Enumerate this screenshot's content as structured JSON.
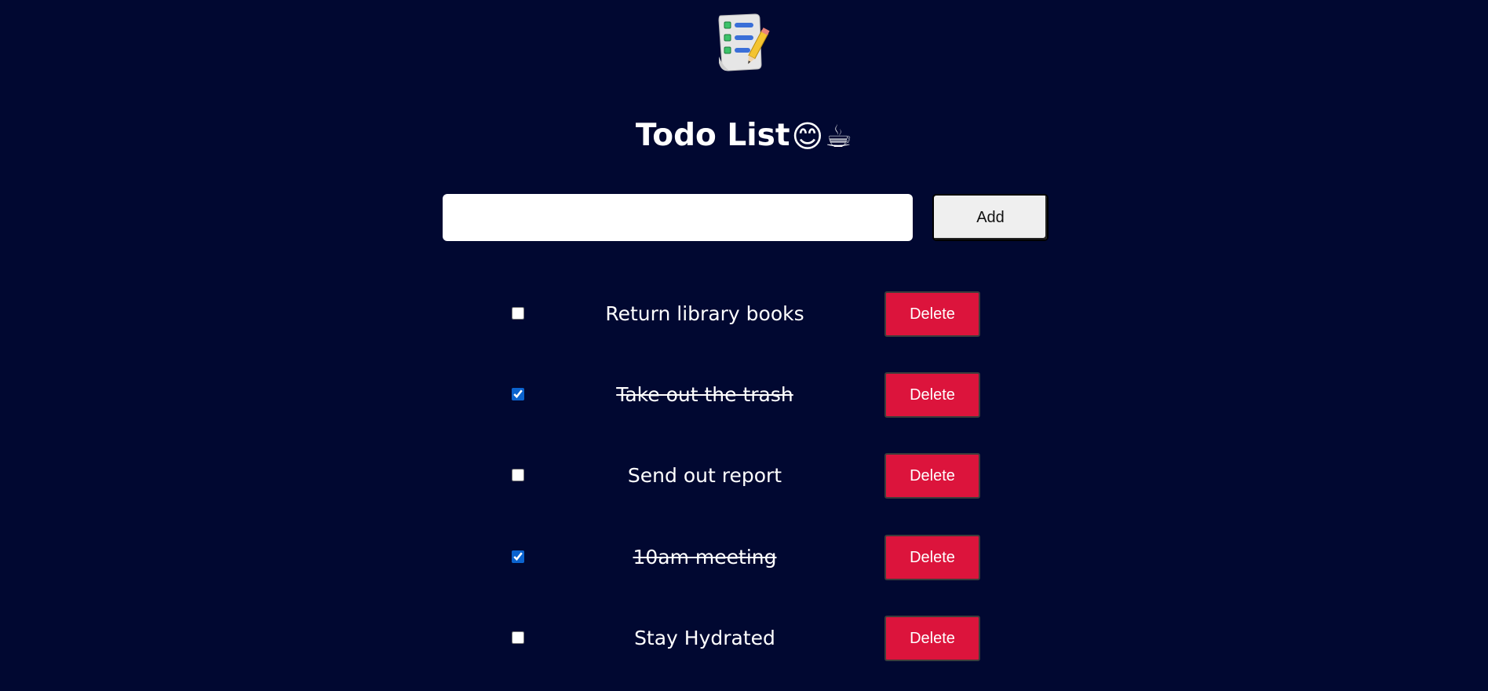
{
  "header": {
    "logo_icon": "todo-notepad-pencil-icon",
    "title": "Todo List",
    "title_emojis": [
      "😊",
      "☕"
    ]
  },
  "form": {
    "input_value": "",
    "input_placeholder": "",
    "add_label": "Add"
  },
  "todos": [
    {
      "text": "Return library books",
      "completed": false,
      "delete_label": "Delete"
    },
    {
      "text": "Take out the trash",
      "completed": true,
      "delete_label": "Delete"
    },
    {
      "text": "Send out report",
      "completed": false,
      "delete_label": "Delete"
    },
    {
      "text": "10am meeting",
      "completed": true,
      "delete_label": "Delete"
    },
    {
      "text": "Stay Hydrated",
      "completed": false,
      "delete_label": "Delete"
    }
  ],
  "colors": {
    "background": "#010831",
    "delete": "#dc143c",
    "checkbox_accent": "#0b63ce",
    "text": "#ffffff"
  }
}
